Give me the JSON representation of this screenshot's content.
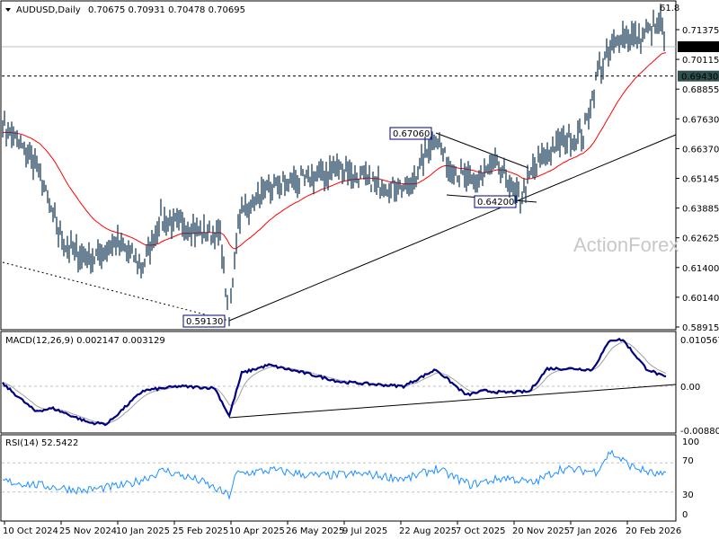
{
  "header": {
    "symbol": "AUDUSD,Daily",
    "ohlc": "0.70675 0.70931 0.70478 0.70695",
    "fib_label": "61.8"
  },
  "watermark": "ActionForex",
  "colors": {
    "bars": "#1b3d5a",
    "ma": "#ff0000",
    "macd": "#000080",
    "signal": "#a0a0a0",
    "rsi": "#1e90ff"
  },
  "chart_data": [
    {
      "type": "line",
      "title": "AUDUSD,Daily",
      "ylim": [
        0.58915,
        0.71375
      ],
      "yticks": [
        "0.71375",
        "0.70115",
        "0.68855",
        "0.67630",
        "0.66370",
        "0.65145",
        "0.63885",
        "0.62625",
        "0.61400",
        "0.60140",
        "0.58915"
      ],
      "xticks": [
        "10 Oct 2024",
        "25 Nov 2024",
        "10 Jan 2025",
        "25 Feb 2025",
        "10 Apr 2025",
        "26 May 2025",
        "9 Jul 2025",
        "22 Aug 2025",
        "7 Oct 2025",
        "20 Nov 2025",
        "7 Jan 2026",
        "20 Feb 2026"
      ],
      "price_keypoints": {
        "bar": [
          0,
          18,
          33,
          48,
          63,
          78,
          88,
          106,
          121,
          126,
          131,
          148,
          168,
          188,
          208,
          226,
          241,
          248,
          263,
          273,
          288,
          295,
          308,
          323,
          331,
          343,
          356,
          366,
          368
        ],
        "close": [
          0.6735,
          0.6584,
          0.6245,
          0.617,
          0.6245,
          0.615,
          0.6339,
          0.63,
          0.628,
          0.5913,
          0.635,
          0.647,
          0.651,
          0.656,
          0.649,
          0.647,
          0.6706,
          0.656,
          0.649,
          0.658,
          0.642,
          0.655,
          0.6659,
          0.67,
          0.696,
          0.711,
          0.711,
          0.7167,
          0.70695
        ]
      },
      "current_price": "0.70695",
      "level_price": "0.69430",
      "annotations": [
        "0.67060",
        "0.64200",
        "0.59130"
      ]
    },
    {
      "type": "line",
      "title": "MACD(12,26,9) 0.002147 0.003129",
      "ylim": [
        -0.008808,
        0.010567
      ],
      "yticks": [
        "0.010567",
        "0.00",
        "-0.008808"
      ],
      "macd_keypoints": {
        "bar": [
          0,
          18,
          28,
          48,
          58,
          78,
          98,
          118,
          126,
          133,
          148,
          168,
          188,
          208,
          223,
          241,
          258,
          268,
          278,
          293,
          303,
          318,
          328,
          338,
          345,
          358,
          368
        ],
        "value": [
          0.0006,
          -0.0056,
          -0.005,
          -0.0082,
          -0.0085,
          -0.001,
          0.0,
          -0.0004,
          -0.0067,
          0.003,
          0.0048,
          0.003,
          0.001,
          0.0004,
          0.0,
          0.0038,
          -0.002,
          -0.001,
          -0.0014,
          -0.0012,
          0.004,
          0.004,
          0.0037,
          0.0105,
          0.0105,
          0.004,
          0.0021
        ]
      }
    },
    {
      "type": "line",
      "title": "RSI(14) 52.5422",
      "ylim": [
        0,
        100
      ],
      "yticks": [
        "100",
        "70",
        "30",
        "0"
      ],
      "rsi_keypoints": {
        "bar": [
          0,
          25,
          45,
          70,
          90,
          110,
          126,
          130,
          150,
          175,
          200,
          225,
          241,
          260,
          280,
          295,
          310,
          330,
          338,
          350,
          362,
          368
        ],
        "value": [
          45,
          38,
          32,
          40,
          60,
          45,
          25,
          55,
          60,
          52,
          55,
          48,
          62,
          40,
          50,
          42,
          62,
          58,
          85,
          65,
          55,
          52.5
        ]
      }
    }
  ]
}
